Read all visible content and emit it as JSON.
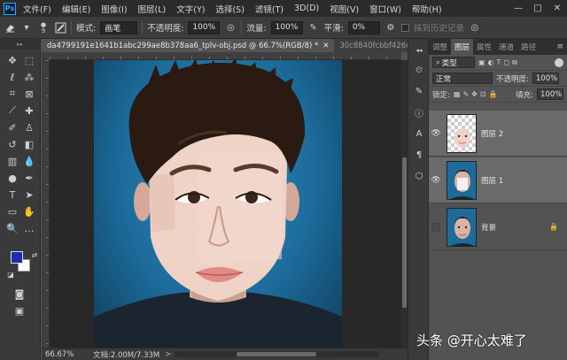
{
  "app": {
    "logo": "Ps"
  },
  "menubar": {
    "items": [
      "文件(F)",
      "编辑(E)",
      "图像(I)",
      "图层(L)",
      "文字(Y)",
      "选择(S)",
      "滤镜(T)",
      "3D(D)",
      "视图(V)",
      "窗口(W)",
      "帮助(H)"
    ],
    "window_controls": [
      "—",
      "□",
      "✕"
    ]
  },
  "optionsbar": {
    "brush_size": "9",
    "mode_label": "模式:",
    "mode_value": "画笔",
    "opacity_label": "不透明度:",
    "opacity_value": "100%",
    "flow_label": "流量:",
    "flow_value": "100%",
    "smoothing_label": "平滑:",
    "smoothing_value": "0%",
    "history_label": "抹到历史记录"
  },
  "document": {
    "tabs": [
      {
        "label": "da4799191e1641b1abc299ae8b378aa6_tplv-obj.psd @ 66.7%(RGB/8) *",
        "close": "✕"
      },
      {
        "label": "30c8840fcbbf426d9ee54ef4dded3"
      }
    ]
  },
  "statusbar": {
    "zoom": "66.67%",
    "doc_info": "文档:2.00M/7.33M",
    "arrow": ">"
  },
  "colors": {
    "foreground": "#1e2cb4",
    "background": "#ffffff",
    "canvas_bg": "#1c6b9b"
  },
  "panel": {
    "tabs": [
      "调整",
      "图层",
      "属性",
      "通道",
      "路径"
    ],
    "active_tab": "图层",
    "filter_type": "类型",
    "blend_mode": "正常",
    "opacity_label": "不透明度:",
    "opacity_value": "100%",
    "lock_label": "锁定:",
    "fill_label": "填充:",
    "fill_value": "100%",
    "layers": [
      {
        "name": "图层 2",
        "visible": true,
        "selected": true,
        "locked": false
      },
      {
        "name": "图层 1",
        "visible": true,
        "selected": true,
        "locked": false
      },
      {
        "name": "背景",
        "visible": false,
        "selected": false,
        "locked": true
      }
    ]
  },
  "watermark": "头条 @开心太难了"
}
